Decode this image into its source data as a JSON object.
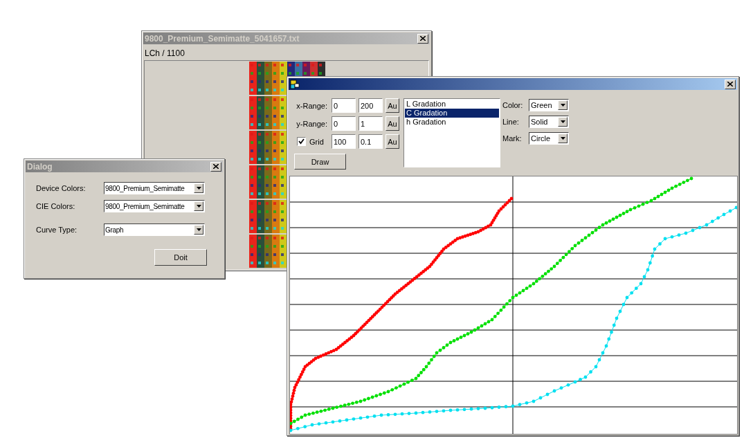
{
  "file_window": {
    "title": "9800_Premium_Semimatte_5041657.txt",
    "active": false,
    "label": "LCh / 1100"
  },
  "dialog": {
    "title": "Dialog",
    "active": false,
    "fields": [
      {
        "label": "Device Colors:",
        "value": "9800_Premium_Semimatte"
      },
      {
        "label": "CIE Colors:",
        "value": "9800_Premium_Semimatte"
      },
      {
        "label": "Curve Type:",
        "value": "Graph"
      }
    ],
    "button": "Doit"
  },
  "graph_window": {
    "active": true,
    "ranges": [
      {
        "kind": "range",
        "label": "x-Range:",
        "min": "0",
        "max": "200",
        "button": "Au"
      },
      {
        "kind": "range",
        "label": "y-Range:",
        "min": "0",
        "max": "1",
        "button": "Au"
      },
      {
        "kind": "checkbox",
        "label": "Grid",
        "checked": true,
        "min": "100",
        "max": "0.1",
        "button": "Au"
      }
    ],
    "draw_button": "Draw",
    "list": [
      {
        "label": "L Gradation",
        "selected": false
      },
      {
        "label": "C Gradation",
        "selected": true
      },
      {
        "label": "h Gradation",
        "selected": false
      }
    ],
    "options": [
      {
        "label": "Color:",
        "value": "Green"
      },
      {
        "label": "Line:",
        "value": "Solid"
      },
      {
        "label": "Mark:",
        "value": "Circle"
      }
    ]
  }
}
